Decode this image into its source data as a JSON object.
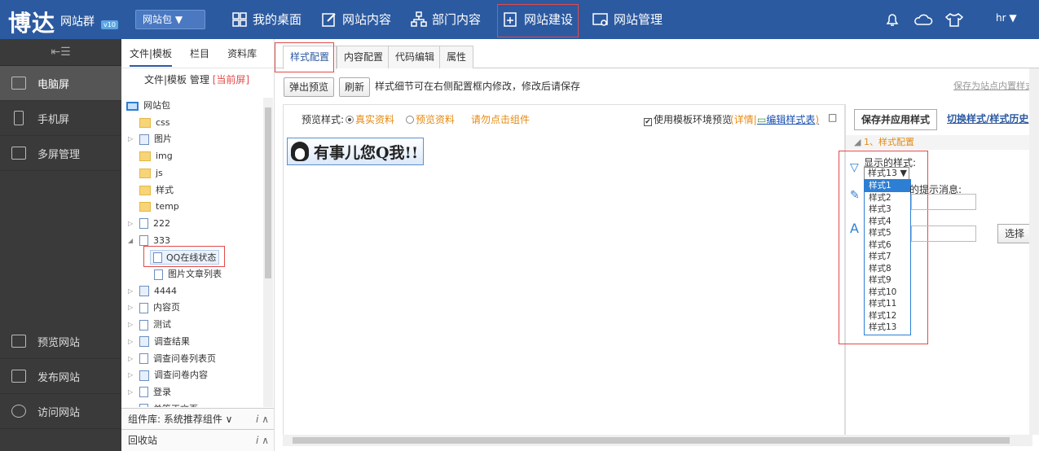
{
  "topbar": {
    "logo": "博达",
    "logo_sub": "网站群",
    "logo_version": "v10",
    "site_package": "网站包 ▼",
    "nav": [
      {
        "label": "我的桌面",
        "icon": "desktop-grid-icon"
      },
      {
        "label": "网站内容",
        "icon": "edit-icon"
      },
      {
        "label": "部门内容",
        "icon": "org-chart-icon"
      },
      {
        "label": "网站建设",
        "icon": "site-build-icon"
      },
      {
        "label": "网站管理",
        "icon": "site-manage-icon"
      }
    ],
    "user": "hr ▼"
  },
  "sidebar": {
    "collapse_icon": "collapse-menu-icon",
    "items": [
      {
        "label": "电脑屏",
        "icon": "desktop-monitor-icon",
        "active": true
      },
      {
        "label": "手机屏",
        "icon": "mobile-phone-icon",
        "active": false
      },
      {
        "label": "多屏管理",
        "icon": "multi-screen-icon",
        "active": false
      }
    ],
    "bottom": [
      {
        "label": "预览网站",
        "icon": "preview-icon"
      },
      {
        "label": "发布网站",
        "icon": "publish-icon"
      },
      {
        "label": "访问网站",
        "icon": "globe-icon"
      }
    ]
  },
  "tree": {
    "tabs": [
      "文件|模板",
      "栏目",
      "资料库"
    ],
    "sub_title": "文件|模板 管理",
    "sub_current": "[当前屏]",
    "nodes": [
      {
        "label": "网站包",
        "type": "monitor",
        "level": 0
      },
      {
        "label": "css",
        "type": "folder",
        "level": 1
      },
      {
        "label": "图片",
        "type": "image",
        "level": 1,
        "arrow": "▷"
      },
      {
        "label": "img",
        "type": "folder",
        "level": 1
      },
      {
        "label": "js",
        "type": "folder",
        "level": 1
      },
      {
        "label": "样式",
        "type": "style",
        "level": 1
      },
      {
        "label": "temp",
        "type": "folder",
        "level": 1
      },
      {
        "label": "222",
        "type": "page",
        "level": 1,
        "arrow": "▷"
      },
      {
        "label": "333",
        "type": "page",
        "level": 1,
        "arrow": "◢"
      },
      {
        "label": "QQ在线状态",
        "type": "widget",
        "level": 2
      },
      {
        "label": "图片文章列表",
        "type": "widget",
        "level": 2
      },
      {
        "label": "4444",
        "type": "pageb",
        "level": 1,
        "arrow": "▷"
      },
      {
        "label": "内容页",
        "type": "page",
        "level": 1,
        "arrow": "▷"
      },
      {
        "label": "测试",
        "type": "page",
        "level": 1,
        "arrow": "▷"
      },
      {
        "label": "调查结果",
        "type": "pageb",
        "level": 1,
        "arrow": "▷"
      },
      {
        "label": "调查问卷列表页",
        "type": "page",
        "level": 1,
        "arrow": "▷"
      },
      {
        "label": "调查问卷内容",
        "type": "pageb",
        "level": 1,
        "arrow": "▷"
      },
      {
        "label": "登录",
        "type": "page",
        "level": 1,
        "arrow": "▷"
      },
      {
        "label": "单篇正文页",
        "type": "page",
        "level": 1,
        "arrow": "▷"
      }
    ],
    "component_lib": "组件库: 系统推荐组件",
    "recycle": "回收站",
    "italic_i": "i"
  },
  "main": {
    "tabs": [
      "样式配置",
      "内容配置",
      "代码编辑",
      "属性"
    ],
    "toolbar": {
      "popup_preview": "弹出预览",
      "refresh": "刷新",
      "hint": "样式细节可在右侧配置框内修改，修改后请保存",
      "save_inner": "保存为站点内置样式"
    },
    "preview_bar": {
      "label": "预览样式:",
      "real": "真实资料",
      "fake": "预览资料",
      "note": "请勿点击组件",
      "use_env": "使用模板环境预览",
      "detail": "详情",
      "edit_style": "编辑样式表"
    },
    "qq_widget_text": "有事儿您Q我!!",
    "prop": {
      "save_apply": "保存并应用样式",
      "switch_history": "切换样式/样式历史",
      "section": "1、样式配置",
      "show_style_label": "显示的样式:",
      "selected_style": "样式13 ▼",
      "options": [
        "样式1",
        "样式2",
        "样式3",
        "样式4",
        "样式5",
        "样式6",
        "样式7",
        "样式8",
        "样式9",
        "样式10",
        "样式11",
        "样式12",
        "样式13"
      ],
      "tip_label": "的提示消息:",
      "choose": "选择"
    }
  }
}
